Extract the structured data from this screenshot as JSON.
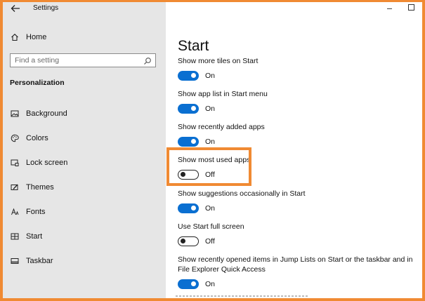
{
  "window": {
    "title": "Settings"
  },
  "sidebar": {
    "home_label": "Home",
    "search_placeholder": "Find a setting",
    "section_heading": "Personalization",
    "items": [
      {
        "label": "Background",
        "icon": "picture-icon"
      },
      {
        "label": "Colors",
        "icon": "palette-icon"
      },
      {
        "label": "Lock screen",
        "icon": "lock-screen-icon"
      },
      {
        "label": "Themes",
        "icon": "brush-icon"
      },
      {
        "label": "Fonts",
        "icon": "font-icon"
      },
      {
        "label": "Start",
        "icon": "start-grid-icon"
      },
      {
        "label": "Taskbar",
        "icon": "taskbar-icon"
      }
    ]
  },
  "main": {
    "title": "Start",
    "settings": [
      {
        "label": "Show more tiles on Start",
        "state": "On"
      },
      {
        "label": "Show app list in Start menu",
        "state": "On"
      },
      {
        "label": "Show recently added apps",
        "state": "On"
      },
      {
        "label": "Show most used apps",
        "state": "Off"
      },
      {
        "label": "Show suggestions occasionally in Start",
        "state": "On"
      },
      {
        "label": "Use Start full screen",
        "state": "Off"
      },
      {
        "label": "Show recently opened items in Jump Lists on Start or the taskbar and in File Explorer Quick Access",
        "state": "On"
      }
    ]
  },
  "colors": {
    "accent": "#0a6fd1",
    "highlight": "#f08a33"
  }
}
